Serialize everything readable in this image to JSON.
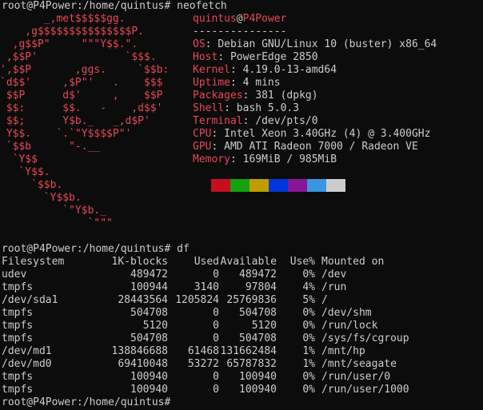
{
  "colors": {
    "background": "#0c0c0c",
    "foreground": "#cccccc",
    "accent_red": "#e74856"
  },
  "prompt": {
    "line1": "root@P4Power:/home/quintus# neofetch",
    "line_df": "root@P4Power:/home/quintus# df",
    "line_last": "root@P4Power:/home/quintus#"
  },
  "logo_art": [
    "       _,met$$$$$gg.",
    "    ,g$$$$$$$$$$$$$$$P.",
    "  ,g$$P\"     \"\"\"Y$$.\".",
    " ,$$P'              `$$$.",
    "',$$P       ,ggs.     `$$b:",
    "`d$$'     ,$P\"'   .    $$$",
    " $$P      d$'     ,    $$P",
    " $$:      $$.   -    ,d$$'",
    " $$;      Y$b._   _,d$P'",
    " Y$$.    `.`\"Y$$$$P\"'",
    " `$$b      \"-.__",
    "  `Y$$",
    "   `Y$$.",
    "     `$$b.",
    "       `Y$$b.",
    "          `\"Y$b._",
    "              `\"\"\""
  ],
  "sysinfo": {
    "user": "quintus",
    "at": "@",
    "host": "P4Power",
    "separator": "---------------",
    "fields": [
      {
        "key": "OS",
        "value": "Debian GNU/Linux 10 (buster) x86_64"
      },
      {
        "key": "Host",
        "value": "PowerEdge 2850"
      },
      {
        "key": "Kernel",
        "value": "4.19.0-13-amd64"
      },
      {
        "key": "Uptime",
        "value": "4 mins"
      },
      {
        "key": "Packages",
        "value": "381 (dpkg)"
      },
      {
        "key": "Shell",
        "value": "bash 5.0.3"
      },
      {
        "key": "Terminal",
        "value": "/dev/pts/0"
      },
      {
        "key": "CPU",
        "value": "Intel Xeon 3.40GHz (4) @ 3.400GHz"
      },
      {
        "key": "GPU",
        "value": "AMD ATI Radeon 7000 / Radeon VE"
      },
      {
        "key": "Memory",
        "value": "169MiB / 985MiB"
      }
    ],
    "palette": [
      "#c50f1f",
      "#13a10e",
      "#c19c00",
      "#0037da",
      "#881798",
      "#3a96dd",
      "#cccccc"
    ]
  },
  "df": {
    "headers": [
      "Filesystem",
      "1K-blocks",
      "Used",
      "Available",
      "Use%",
      "Mounted on"
    ],
    "rows": [
      [
        "udev",
        "489472",
        "0",
        "489472",
        "0%",
        "/dev"
      ],
      [
        "tmpfs",
        "100944",
        "3140",
        "97804",
        "4%",
        "/run"
      ],
      [
        "/dev/sda1",
        "28443564",
        "1205824",
        "25769836",
        "5%",
        "/"
      ],
      [
        "tmpfs",
        "504708",
        "0",
        "504708",
        "0%",
        "/dev/shm"
      ],
      [
        "tmpfs",
        "5120",
        "0",
        "5120",
        "0%",
        "/run/lock"
      ],
      [
        "tmpfs",
        "504708",
        "0",
        "504708",
        "0%",
        "/sys/fs/cgroup"
      ],
      [
        "/dev/md1",
        "138846688",
        "61468",
        "131662484",
        "1%",
        "/mnt/hp"
      ],
      [
        "/dev/md0",
        "69410048",
        "53272",
        "65787832",
        "1%",
        "/mnt/seagate"
      ],
      [
        "tmpfs",
        "100940",
        "0",
        "100940",
        "0%",
        "/run/user/0"
      ],
      [
        "tmpfs",
        "100940",
        "0",
        "100940",
        "0%",
        "/run/user/1000"
      ]
    ]
  }
}
